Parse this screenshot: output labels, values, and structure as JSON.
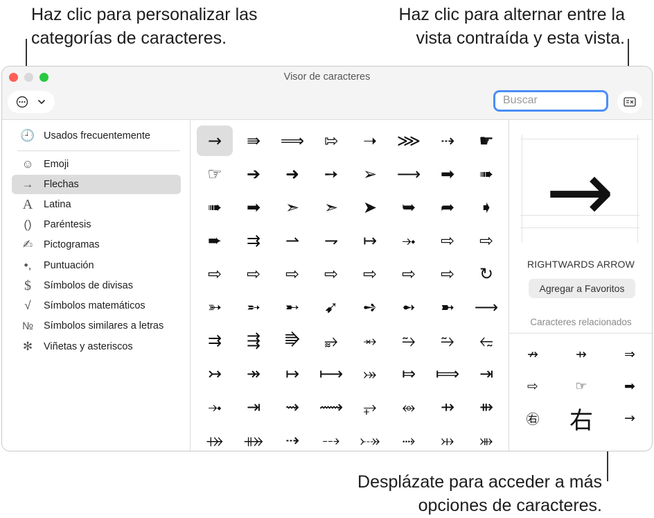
{
  "callouts": {
    "top_left": [
      "Haz clic para personalizar las",
      "categorías de caracteres."
    ],
    "top_right": [
      "Haz clic para alternar entre la",
      "vista contraída y esta vista."
    ],
    "bottom_right": [
      "Desplázate para acceder a más",
      "opciones de caracteres."
    ]
  },
  "window": {
    "title": "Visor de caracteres",
    "traffic_lights": {
      "close": "#fe5f57",
      "minimize": "#d9d9d9",
      "zoom": "#28c840"
    },
    "toolbar": {
      "options_icon": "ellipsis-circle-icon",
      "dropdown_icon": "chevron-down-icon",
      "toggle_view_icon": "collapse-view-icon"
    },
    "search": {
      "placeholder": "Buscar",
      "value": ""
    }
  },
  "sidebar": {
    "items": [
      {
        "icon": "clock-icon",
        "glyph": "🕘",
        "label": "Usados frecuentemente"
      },
      {
        "icon": "smiley-icon",
        "glyph": "☺",
        "label": "Emoji"
      },
      {
        "icon": "arrow-icon",
        "glyph": "→",
        "label": "Flechas",
        "selected": true
      },
      {
        "icon": "latin-a-icon",
        "glyph": "A",
        "label": "Latina"
      },
      {
        "icon": "parentheses-icon",
        "glyph": "()",
        "label": "Paréntesis"
      },
      {
        "icon": "pictograph-icon",
        "glyph": "✍",
        "label": "Pictogramas"
      },
      {
        "icon": "punctuation-icon",
        "glyph": "•,",
        "label": "Puntuación"
      },
      {
        "icon": "dollar-icon",
        "glyph": "$",
        "label": "Símbolos de divisas"
      },
      {
        "icon": "sqrt-icon",
        "glyph": "√",
        "label": "Símbolos matemáticos"
      },
      {
        "icon": "numero-icon",
        "glyph": "№",
        "label": "Símbolos similares a letras"
      },
      {
        "icon": "asterisk-icon",
        "glyph": "✻",
        "label": "Viñetas y asteriscos"
      }
    ]
  },
  "grid": {
    "rows": [
      [
        "→",
        "⇛",
        "⟹",
        "⇰",
        "➝",
        "⋙",
        "⇢",
        "☛"
      ],
      [
        "☞",
        "➔",
        "➜",
        "➙",
        "➢",
        "⟶",
        "➡",
        "➠"
      ],
      [
        "➠",
        "➡",
        "➣",
        "➣",
        "➤",
        "➥",
        "➦",
        "➧"
      ],
      [
        "➨",
        "⇉",
        "⇀",
        "⇁",
        "↦",
        "⤞",
        "⇨",
        "⇨"
      ],
      [
        "⇨",
        "⇨",
        "⇨",
        "⇨",
        "⇨",
        "⇨",
        "⇨",
        "↻"
      ],
      [
        "➳",
        "➵",
        "➸",
        "➹",
        "➺",
        "➻",
        "➼",
        "⟶"
      ],
      [
        "⇉",
        "⇶",
        "⭆",
        "⥵",
        "⥇",
        "⥲",
        "⥲",
        "⥳"
      ],
      [
        "↣",
        "↠",
        "↦",
        "⟼",
        "⤖",
        "⤇",
        "⟾",
        "⇥"
      ],
      [
        "⤞",
        "⇥",
        "⇝",
        "⟿",
        "⥅",
        "⥈",
        "⇸",
        "⇻"
      ],
      [
        "⤀",
        "⤁",
        "⇢",
        "⤏",
        "⤐",
        "⤑",
        "⤔",
        "⤕"
      ]
    ],
    "selected": [
      0,
      0
    ]
  },
  "detail": {
    "character": "→",
    "name": "RIGHTWARDS ARROW",
    "favorite_button": "Agregar a Favoritos",
    "related_heading": "Caracteres relacionados",
    "related": [
      "↛",
      "⇸",
      "⇒",
      "⇨",
      "☞",
      "➡",
      "㊨",
      "右",
      "→"
    ]
  }
}
